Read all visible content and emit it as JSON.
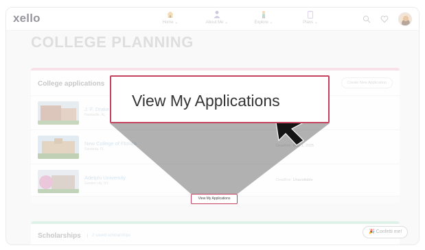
{
  "app": {
    "logo": "xello"
  },
  "nav": {
    "items": [
      {
        "label": "Home",
        "icon": "home-icon"
      },
      {
        "label": "About Me",
        "icon": "person-icon"
      },
      {
        "label": "Explore",
        "icon": "explorer-icon"
      },
      {
        "label": "Plans",
        "icon": "clipboard-icon"
      }
    ],
    "right_icons": [
      "search-icon",
      "heart-icon",
      "avatar"
    ]
  },
  "page": {
    "title": "COLLEGE PLANNING"
  },
  "college_applications": {
    "title": "College applications",
    "create_button": "Create New Application",
    "rows": [
      {
        "name": "J. F. Drake St",
        "location": "Huntsville, AL",
        "deadline_label": "",
        "deadline_value": ""
      },
      {
        "name": "New College of Florida",
        "location": "Sarasota, FL",
        "deadline_label": "Deadline:",
        "deadline_value": "May 1, 2025"
      },
      {
        "name": "Adelphi University",
        "location": "Garden city, NY",
        "deadline_label": "Deadline:",
        "deadline_value": "Unavailable"
      }
    ]
  },
  "scholarships": {
    "title": "Scholarships",
    "count": "2 saved scholarships"
  },
  "confetti_button": "🎉 Confetti me!",
  "tutorial": {
    "callout_text": "View My Applications",
    "target_button": "View My Applications"
  },
  "colors": {
    "highlight": "#c4425d",
    "college_accent": "#f0c3d0",
    "scholarship_accent": "#bfe5d4",
    "link": "#a9c6de"
  }
}
